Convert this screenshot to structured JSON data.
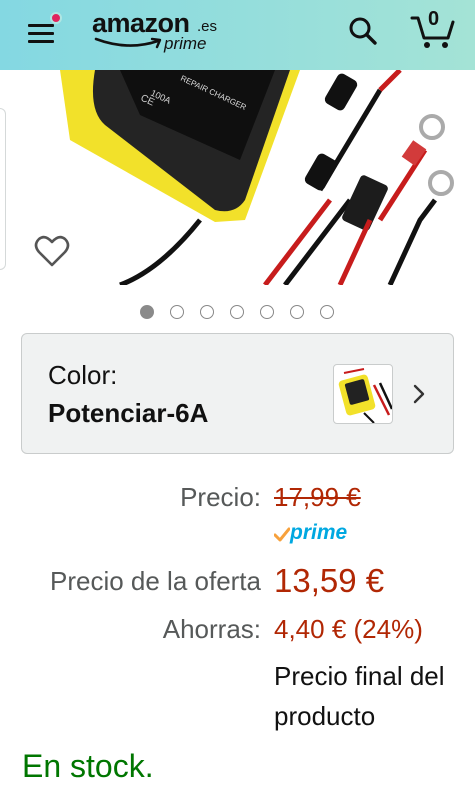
{
  "header": {
    "logo": {
      "word": "amazon",
      "tld": ".es",
      "sub": "prime"
    },
    "cart_count": "0",
    "colors": {
      "gradient_start": "#84d8e2",
      "gradient_end": "#a4e3d6",
      "notification_dot": "#e0245e"
    },
    "icons": [
      "menu-icon",
      "search-icon",
      "cart-icon"
    ]
  },
  "gallery": {
    "image_count": 7,
    "active_index": 0,
    "wishlist_icon": "heart-outline-icon",
    "image_text": [
      "100A",
      "REPAIR CHARGER",
      "CE"
    ]
  },
  "variation": {
    "label": "Color:",
    "value": "Potenciar-6A",
    "chevron_icon": "chevron-right-icon"
  },
  "pricing": {
    "list_label": "Precio:",
    "list_price": "17,99 €",
    "prime_label": "prime",
    "deal_label": "Precio de la oferta",
    "deal_price": "13,59 €",
    "savings_label": "Ahorras:",
    "savings_value": "4,40 € (24%)",
    "final_note": "Precio final del producto",
    "colors": {
      "price": "#b12704",
      "prime": "#00a8e1",
      "label": "#565959"
    }
  },
  "availability": {
    "text": "En stock.",
    "color": "#007600"
  }
}
